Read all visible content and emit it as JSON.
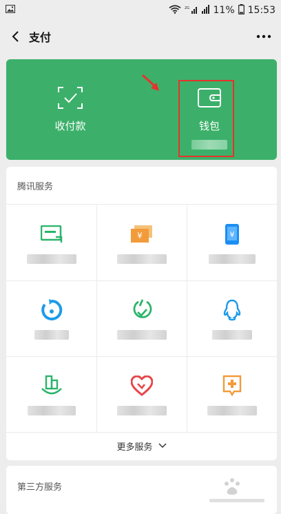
{
  "status_bar": {
    "battery_percent": "11%",
    "time": "15:53"
  },
  "nav": {
    "title": "支付"
  },
  "top_card": {
    "pay_label": "收付款",
    "wallet_label": "钱包"
  },
  "tencent_services": {
    "header": "腾讯服务",
    "more_label": "更多服务"
  },
  "third_party": {
    "header": "第三方服务"
  },
  "colors": {
    "brand_green": "#3cb06a",
    "highlight_red": "#e8322b"
  }
}
